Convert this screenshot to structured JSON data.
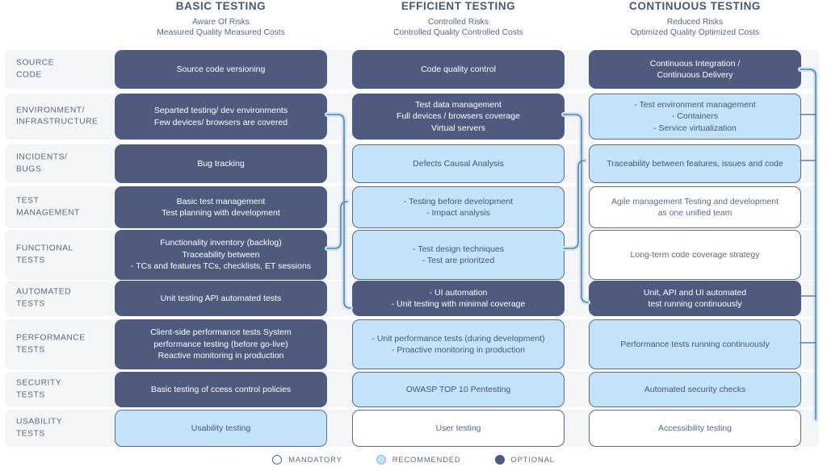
{
  "columns": [
    {
      "title": "BASIC TESTING",
      "sub1": "Aware Of Risks",
      "sub2": "Measured Quality Measured Costs"
    },
    {
      "title": "EFFICIENT TESTING",
      "sub1": "Controlled Risks",
      "sub2": "Controlled Quality Controlled Costs"
    },
    {
      "title": "CONTINUOUS TESTING",
      "sub1": "Reduced Risks",
      "sub2": "Optimized Quality Optimized Costs"
    }
  ],
  "rows": [
    {
      "label_line1": "SOURCE",
      "label_line2": "CODE",
      "cells": [
        {
          "level": "optional",
          "lines": [
            "Source code versioning"
          ]
        },
        {
          "level": "optional",
          "lines": [
            "Code quality control"
          ]
        },
        {
          "level": "optional",
          "lines": [
            "Continuous Integration /",
            "Continuous Delivery"
          ]
        }
      ]
    },
    {
      "label_line1": "ENVIRONMENT/",
      "label_line2": "INFRASTRUCTURE",
      "cells": [
        {
          "level": "optional",
          "lines": [
            "Separted testing/ dev environments",
            "Few devices/ browsers are covered"
          ]
        },
        {
          "level": "optional",
          "lines": [
            "Test data management",
            "Full devices / browsers coverage",
            "Virtual servers"
          ]
        },
        {
          "level": "recommended",
          "lines": [
            "- Test environment management",
            "- Containers",
            "- Service virtualization"
          ]
        }
      ]
    },
    {
      "label_line1": "INCIDENTS/",
      "label_line2": "BUGS",
      "cells": [
        {
          "level": "optional",
          "lines": [
            "Bug tracking"
          ]
        },
        {
          "level": "recommended",
          "lines": [
            "Defects Causal Analysis"
          ]
        },
        {
          "level": "recommended",
          "lines": [
            "Traceability between features, issues and code"
          ]
        }
      ]
    },
    {
      "label_line1": "TEST",
      "label_line2": "MANAGEMENT",
      "cells": [
        {
          "level": "optional",
          "lines": [
            "Basic test management",
            "Test planning with development"
          ]
        },
        {
          "level": "recommended",
          "lines": [
            "- Testing before development",
            "- Impact analysis"
          ]
        },
        {
          "level": "mandatory",
          "lines": [
            "Agile management Testing and development",
            "as one unified team"
          ]
        }
      ]
    },
    {
      "label_line1": "FUNCTIONAL",
      "label_line2": "TESTS",
      "cells": [
        {
          "level": "optional",
          "lines": [
            "Functionality inventory (backlog)",
            "Traceability between",
            "- TCs and features TCs, checklists, ET sessions"
          ]
        },
        {
          "level": "recommended",
          "lines": [
            "- Test design techniques",
            "- Test are prioritzed"
          ]
        },
        {
          "level": "mandatory",
          "lines": [
            "Long-term code coverage strategy"
          ]
        }
      ]
    },
    {
      "label_line1": "AUTOMATED",
      "label_line2": "TESTS",
      "cells": [
        {
          "level": "optional",
          "lines": [
            "Unit testing API automated tests"
          ]
        },
        {
          "level": "optional",
          "lines": [
            "- UI automation",
            "- Unit testing with minimal coverage"
          ]
        },
        {
          "level": "optional",
          "lines": [
            "Unit, API and UI automated",
            "test running continuously"
          ]
        }
      ]
    },
    {
      "label_line1": "PERFORMANCE",
      "label_line2": "TESTS",
      "cells": [
        {
          "level": "optional",
          "lines": [
            "Client-side performance tests System",
            "performance testing (before go-live)",
            "Reactive monitoring in production"
          ]
        },
        {
          "level": "recommended",
          "lines": [
            "- Unit performance tests (during development)",
            "- Proactive monitoring in production"
          ]
        },
        {
          "level": "recommended",
          "lines": [
            "Performance tests running continuously"
          ]
        }
      ]
    },
    {
      "label_line1": "SECURITY",
      "label_line2": "TESTS",
      "cells": [
        {
          "level": "optional",
          "lines": [
            "Basic testing of ccess control policies"
          ]
        },
        {
          "level": "recommended",
          "lines": [
            "OWASP TOP 10 Pentesting"
          ]
        },
        {
          "level": "recommended",
          "lines": [
            "Automated security checks"
          ]
        }
      ]
    },
    {
      "label_line1": "USABILITY",
      "label_line2": "TESTS",
      "cells": [
        {
          "level": "recommended",
          "lines": [
            "Usability testing"
          ]
        },
        {
          "level": "mandatory",
          "lines": [
            "User testing"
          ]
        },
        {
          "level": "mandatory",
          "lines": [
            "Accessibility testing"
          ]
        }
      ]
    }
  ],
  "legend": [
    {
      "key": "mandatory",
      "label": "MANDATORY"
    },
    {
      "key": "recommended",
      "label": "RECOMMENDED"
    },
    {
      "key": "optional",
      "label": "OPTIONAL"
    }
  ],
  "colors": {
    "optional": "#4E5B7E",
    "recommended": "#C2E3F9",
    "mandatory": "#FFFFFF",
    "border": "#5E6B88",
    "connector": "#5E7FA6",
    "connector_halo": "#CFE6F7",
    "row_stripe": "#F4F5F7",
    "text": "#5C6884"
  }
}
